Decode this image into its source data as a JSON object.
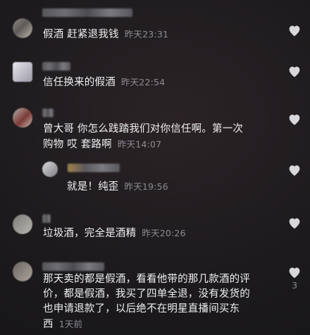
{
  "comments": [
    {
      "text": "假酒 赶紧退我钱",
      "time": "昨天23:31"
    },
    {
      "text": "信任换来的假酒",
      "time": "昨天22:54"
    },
    {
      "text_line1": "曾大哥 你怎么践踏我们对你信任啊。第一次",
      "text_line2": "购物 哎 套路啊",
      "time": "昨天14:07",
      "reply": {
        "text": "就是！纯歪",
        "time": "昨天19:56"
      }
    },
    {
      "text": "垃圾酒，完全是酒精",
      "time": "昨天20:26"
    },
    {
      "lines": [
        "那天卖的都是假酒，看看他带的那几款酒的评",
        "价，都是假酒，我买了四单全退，没有发货的",
        "也申请退款了，以后绝不在明星直播间买东"
      ],
      "last_line": "西",
      "time": "1天前",
      "likes": "3"
    }
  ],
  "colors": {
    "background": "#1c1a1d",
    "text": "#f0f0f2",
    "meta": "#8c8c94",
    "like_icon": "#d8d8dc"
  },
  "icons": {
    "like": "heart-icon"
  }
}
